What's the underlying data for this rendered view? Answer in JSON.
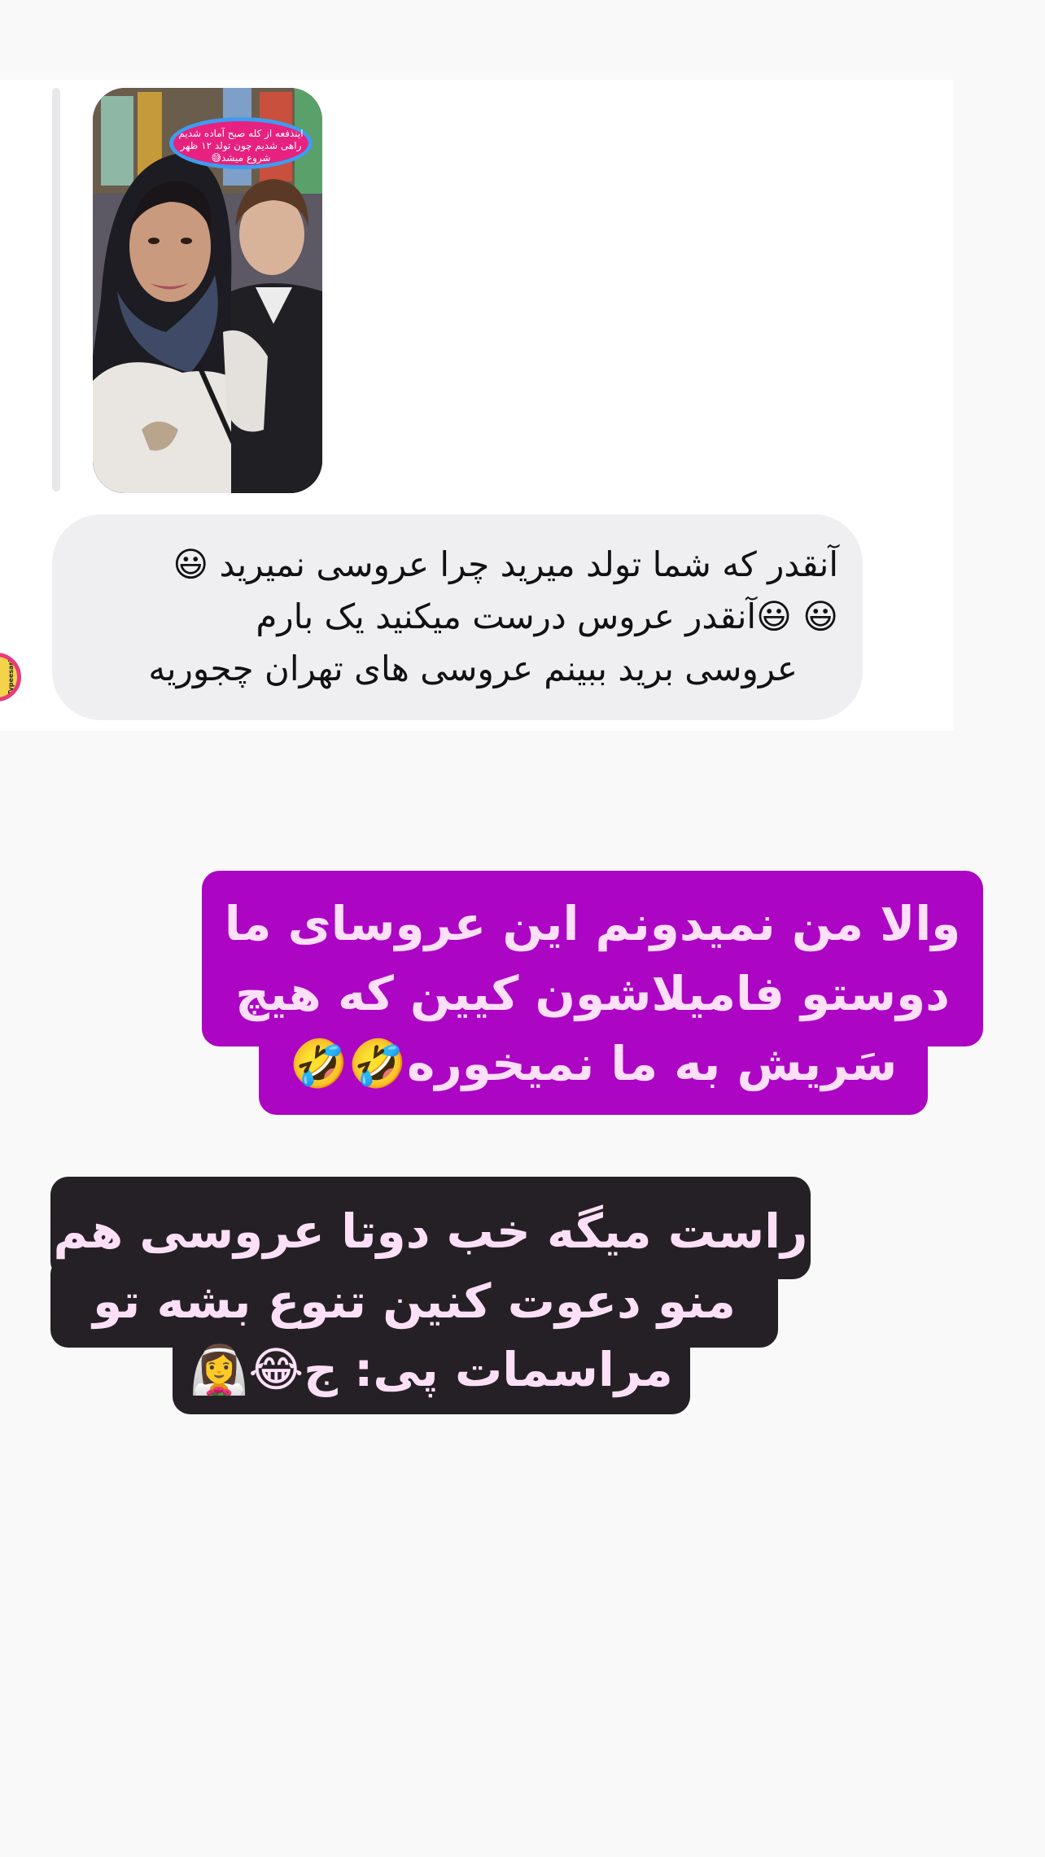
{
  "story_reply": {
    "sticker_text_line1": "اینذفعه از کله صبح آماده شدیم",
    "sticker_text_line2": "راهی شدیم چون تولد ۱۲ ظهر",
    "sticker_text_line3": "شروع میشد😅"
  },
  "message": {
    "line1": "آنقدر که شما تولد میرید چرا عروسی نمیرید 😃",
    "line2": "😃 😃آنقدر عروس درست میکنید یک بارم",
    "line3": "عروسی برید ببینم عروسی های تهران چجوریه"
  },
  "avatar": {
    "label": "Typeesari"
  },
  "caption_purple": {
    "line1": "والا من نمیدونم این عروسای ما",
    "line2": "دوستو فامیلاشون کیین که هیچ",
    "line3": "سَریش به ما نمیخوره🤣🤣"
  },
  "caption_dark": {
    "line1": "راست میگه خب دوتا عروسی هم",
    "line2": "منو دعوت کنین تنوع بشه تو",
    "line3": "مراسمات پی: ج😂👰‍♀️"
  },
  "colors": {
    "purple_caption_bg": "#ac05c4",
    "dark_caption_bg": "#252025",
    "caption_text": "#fde0f7",
    "bubble_bg": "#efeff1",
    "story_sticker_bg": "#e7217f",
    "story_sticker_border": "#3e9cf0"
  }
}
